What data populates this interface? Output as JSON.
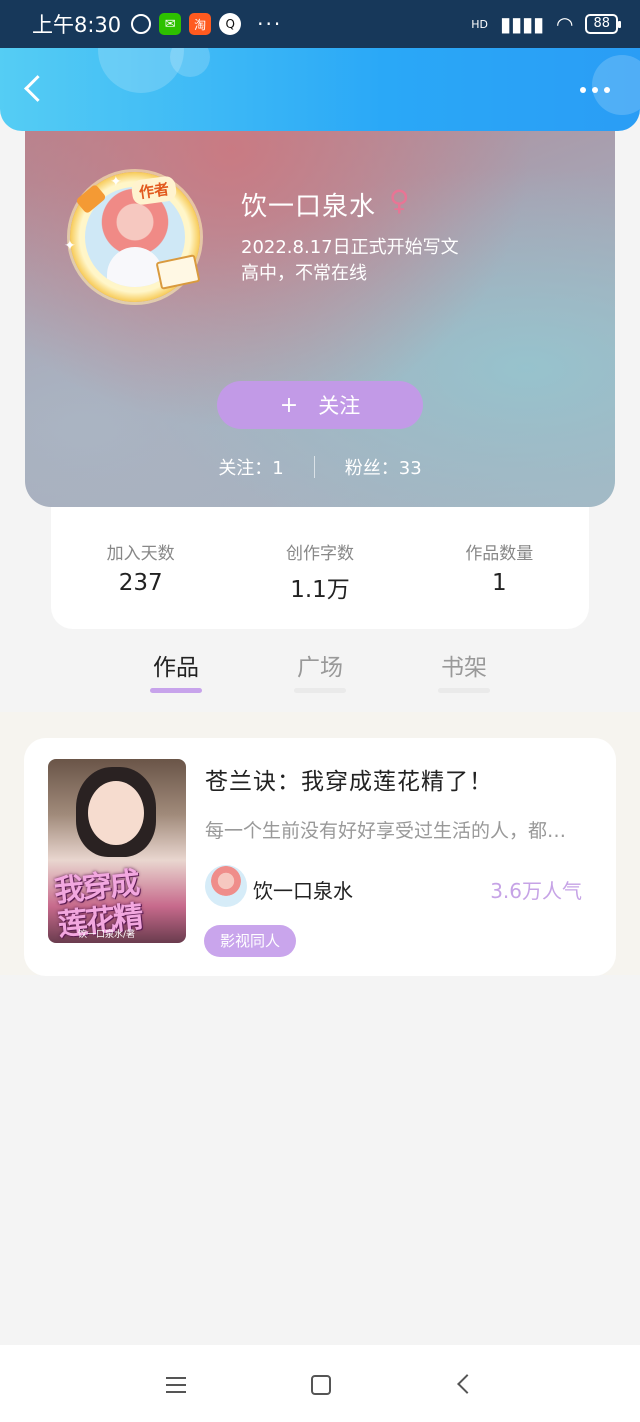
{
  "status_bar": {
    "time": "上午8:30",
    "more": "···",
    "network": "HD",
    "battery": "88"
  },
  "header": {
    "back_icon": "chevron-left-icon",
    "more_icon": "more-horizontal-icon"
  },
  "profile": {
    "avatar_badge": "作者",
    "name": "饮一口泉水",
    "gender_symbol": "♀",
    "start_date": "2022.8.17日正式开始写文",
    "status_line": "高中，不常在线",
    "follow_button": {
      "plus": "+",
      "label": "关注"
    },
    "following": "关注：1",
    "fans": "粉丝：33"
  },
  "stats": [
    {
      "label": "加入天数",
      "value": "237"
    },
    {
      "label": "创作字数",
      "value": "1.1万"
    },
    {
      "label": "作品数量",
      "value": "1"
    }
  ],
  "tabs": [
    {
      "label": "作品",
      "active": true
    },
    {
      "label": "广场",
      "active": false
    },
    {
      "label": "书架",
      "active": false
    }
  ],
  "book": {
    "cover_title_line1": "我穿成",
    "cover_title_line2": "莲花精",
    "cover_subtitle": "饮一口泉水/著",
    "title": "苍兰诀：我穿成莲花精了！",
    "description": "每一个生前没有好好享受过生活的人，都…",
    "author": "饮一口泉水",
    "popularity": "3.6万人气",
    "tag": "影视同人"
  },
  "colors": {
    "accent_purple": "#c29ae7",
    "header_blue": "#2aa8f7",
    "popularity_purple": "#c6a3e6"
  }
}
